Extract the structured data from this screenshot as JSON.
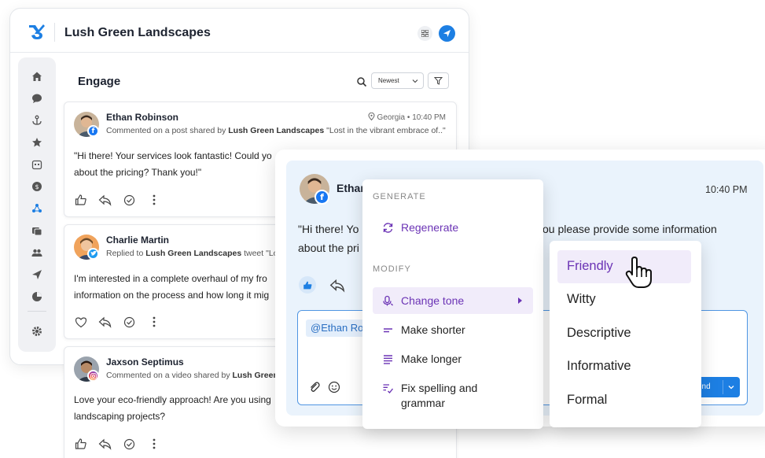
{
  "app": {
    "title": "Lush Green Landscapes"
  },
  "engage": {
    "title": "Engage",
    "sort": {
      "selected": "Newest"
    }
  },
  "cards": [
    {
      "author": "Ethan Robinson",
      "platform": "facebook",
      "meta_prefix": "Commented on a post shared by ",
      "meta_brand": "Lush Green Landscapes",
      "meta_suffix": " \"Lost in the vibrant embrace of..\"",
      "location": "Georgia",
      "time": "10:40 PM",
      "line1": "\"Hi there! Your services look fantastic! Could yo",
      "line2": "about the pricing? Thank you!\""
    },
    {
      "author": "Charlie Martin",
      "platform": "twitter",
      "meta_prefix": "Replied to ",
      "meta_brand": "Lush Green Landscapes",
      "meta_suffix": " tweet \"Los",
      "line1": "I'm interested in a complete overhaul of my fro",
      "line2": "information on the process and how long it mig"
    },
    {
      "author": "Jaxson Septimus",
      "platform": "instagram",
      "meta_prefix": "Commented on a video shared by ",
      "meta_brand": "Lush Green",
      "meta_suffix": "",
      "line1": "Love your eco-friendly approach! Are you using",
      "line2": "landscaping projects?"
    }
  ],
  "reply_panel": {
    "author": "Ethan",
    "time": "10:40 PM",
    "msg_a": "\"Hi there! Yo",
    "msg_b": "ou please provide some information",
    "msg_c": "about the pri",
    "mention": "@Ethan Ro",
    "send_label": "end"
  },
  "ai_menu": {
    "generate_heading": "GENERATE",
    "regenerate": "Regenerate",
    "modify_heading": "MODIFY",
    "change_tone": "Change tone",
    "make_shorter": "Make shorter",
    "make_longer": "Make longer",
    "fix_line1": "Fix spelling and",
    "fix_line2": "grammar"
  },
  "tone_menu": {
    "options": [
      "Friendly",
      "Witty",
      "Descriptive",
      "Informative",
      "Formal"
    ],
    "selected": "Friendly"
  },
  "colors": {
    "brand_blue": "#1d7fe3",
    "accent_purple": "#6b33b5",
    "highlight_purple": "#f1ecfa",
    "panel_blue": "#eaf3fc"
  }
}
